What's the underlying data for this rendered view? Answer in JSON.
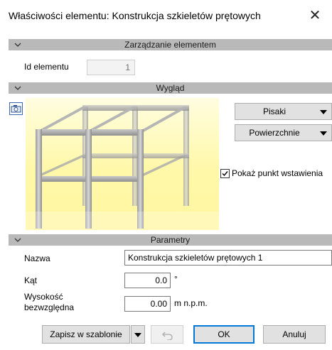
{
  "window": {
    "title": "Właściwości elementu: Konstrukcja szkieletów prętowych",
    "close_glyph": "✕"
  },
  "sections": {
    "element_management": {
      "header": "Zarządzanie elementem",
      "id_label": "Id elementu",
      "id_value": "1"
    },
    "appearance": {
      "header": "Wygląd",
      "pens_button": "Pisaki",
      "surfaces_button": "Powierzchnie",
      "show_insert_point_label": "Pokaż punkt wstawienia",
      "show_insert_point_checked": true
    },
    "parameters": {
      "header": "Parametry",
      "name_label": "Nazwa",
      "name_value": "Konstrukcja szkieletów prętowych 1",
      "angle_label": "Kąt",
      "angle_value": "0.0",
      "angle_unit": "°",
      "height_label_line1": "Wysokość",
      "height_label_line2": "bezwzględna",
      "height_value": "0.00",
      "height_unit": "m n.p.m."
    }
  },
  "footer": {
    "save_template": "Zapisz w szablonie",
    "ok": "OK",
    "cancel": "Anuluj"
  },
  "colors": {
    "section_header_bg": "#b9b9b9",
    "preview_bg": "#fff8a8",
    "ok_border": "#0078d7"
  },
  "icons": {
    "section_toggle": "chevron-down-icon",
    "dropdown": "caret-down-icon",
    "preview_camera": "camera-icon",
    "undo": "undo-icon",
    "close": "close-icon"
  }
}
